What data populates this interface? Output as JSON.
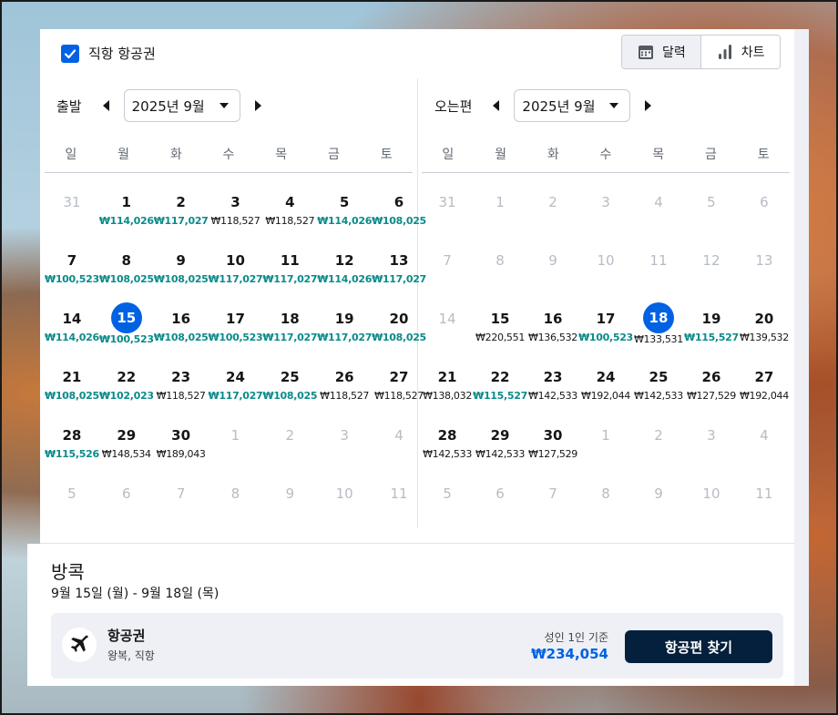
{
  "options": {
    "direct_label": "직항 항공권",
    "direct_checked": true
  },
  "view_toggle": {
    "calendar_label": "달력",
    "chart_label": "차트"
  },
  "weekdays": [
    "일",
    "월",
    "화",
    "수",
    "목",
    "금",
    "토"
  ],
  "depart": {
    "label": "출발",
    "month": "2025년 9월",
    "days": [
      {
        "d": "31",
        "muted": true
      },
      {
        "d": "1",
        "p": "₩114,026",
        "c": true
      },
      {
        "d": "2",
        "p": "₩117,027",
        "c": true
      },
      {
        "d": "3",
        "p": "₩118,527"
      },
      {
        "d": "4",
        "p": "₩118,527"
      },
      {
        "d": "5",
        "p": "₩114,026",
        "c": true
      },
      {
        "d": "6",
        "p": "₩108,025",
        "c": true
      },
      {
        "d": "7",
        "p": "₩100,523",
        "c": true
      },
      {
        "d": "8",
        "p": "₩108,025",
        "c": true
      },
      {
        "d": "9",
        "p": "₩108,025",
        "c": true
      },
      {
        "d": "10",
        "p": "₩117,027",
        "c": true
      },
      {
        "d": "11",
        "p": "₩117,027",
        "c": true
      },
      {
        "d": "12",
        "p": "₩114,026",
        "c": true
      },
      {
        "d": "13",
        "p": "₩117,027",
        "c": true
      },
      {
        "d": "14",
        "p": "₩114,026",
        "c": true
      },
      {
        "d": "15",
        "p": "₩100,523",
        "c": true,
        "sel": true
      },
      {
        "d": "16",
        "p": "₩108,025",
        "c": true
      },
      {
        "d": "17",
        "p": "₩100,523",
        "c": true
      },
      {
        "d": "18",
        "p": "₩117,027",
        "c": true
      },
      {
        "d": "19",
        "p": "₩117,027",
        "c": true
      },
      {
        "d": "20",
        "p": "₩108,025",
        "c": true
      },
      {
        "d": "21",
        "p": "₩108,025",
        "c": true
      },
      {
        "d": "22",
        "p": "₩102,023",
        "c": true
      },
      {
        "d": "23",
        "p": "₩118,527"
      },
      {
        "d": "24",
        "p": "₩117,027",
        "c": true
      },
      {
        "d": "25",
        "p": "₩108,025",
        "c": true
      },
      {
        "d": "26",
        "p": "₩118,527"
      },
      {
        "d": "27",
        "p": "₩118,527"
      },
      {
        "d": "28",
        "p": "₩115,526",
        "c": true
      },
      {
        "d": "29",
        "p": "₩148,534"
      },
      {
        "d": "30",
        "p": "₩189,043"
      },
      {
        "d": "1",
        "muted": true
      },
      {
        "d": "2",
        "muted": true
      },
      {
        "d": "3",
        "muted": true
      },
      {
        "d": "4",
        "muted": true
      },
      {
        "d": "5",
        "muted": true
      },
      {
        "d": "6",
        "muted": true
      },
      {
        "d": "7",
        "muted": true
      },
      {
        "d": "8",
        "muted": true
      },
      {
        "d": "9",
        "muted": true
      },
      {
        "d": "10",
        "muted": true
      },
      {
        "d": "11",
        "muted": true
      }
    ]
  },
  "return": {
    "label": "오는편",
    "month": "2025년 9월",
    "days": [
      {
        "d": "31",
        "muted": true
      },
      {
        "d": "1",
        "muted": true
      },
      {
        "d": "2",
        "muted": true
      },
      {
        "d": "3",
        "muted": true
      },
      {
        "d": "4",
        "muted": true
      },
      {
        "d": "5",
        "muted": true
      },
      {
        "d": "6",
        "muted": true
      },
      {
        "d": "7",
        "muted": true
      },
      {
        "d": "8",
        "muted": true
      },
      {
        "d": "9",
        "muted": true
      },
      {
        "d": "10",
        "muted": true
      },
      {
        "d": "11",
        "muted": true
      },
      {
        "d": "12",
        "muted": true
      },
      {
        "d": "13",
        "muted": true
      },
      {
        "d": "14",
        "muted": true
      },
      {
        "d": "15",
        "p": "₩220,551"
      },
      {
        "d": "16",
        "p": "₩136,532"
      },
      {
        "d": "17",
        "p": "₩100,523",
        "c": true
      },
      {
        "d": "18",
        "p": "₩133,531",
        "sel": true
      },
      {
        "d": "19",
        "p": "₩115,527",
        "c": true
      },
      {
        "d": "20",
        "p": "₩139,532"
      },
      {
        "d": "21",
        "p": "₩138,032"
      },
      {
        "d": "22",
        "p": "₩115,527",
        "c": true
      },
      {
        "d": "23",
        "p": "₩142,533"
      },
      {
        "d": "24",
        "p": "₩192,044"
      },
      {
        "d": "25",
        "p": "₩142,533"
      },
      {
        "d": "26",
        "p": "₩127,529"
      },
      {
        "d": "27",
        "p": "₩192,044"
      },
      {
        "d": "28",
        "p": "₩142,533"
      },
      {
        "d": "29",
        "p": "₩142,533"
      },
      {
        "d": "30",
        "p": "₩127,529"
      },
      {
        "d": "1",
        "muted": true
      },
      {
        "d": "2",
        "muted": true
      },
      {
        "d": "3",
        "muted": true
      },
      {
        "d": "4",
        "muted": true
      },
      {
        "d": "5",
        "muted": true
      },
      {
        "d": "6",
        "muted": true
      },
      {
        "d": "7",
        "muted": true
      },
      {
        "d": "8",
        "muted": true
      },
      {
        "d": "9",
        "muted": true
      },
      {
        "d": "10",
        "muted": true
      },
      {
        "d": "11",
        "muted": true
      }
    ]
  },
  "summary": {
    "destination": "방콕",
    "dates": "9월 15일 (월) - 9월 18일 (목)",
    "flight_title": "항공권",
    "flight_sub": "왕복, 직항",
    "basis": "성인 1인 기준",
    "price": "₩234,054",
    "find_button": "항공편 찾기"
  },
  "colors": {
    "accent": "#0062e3",
    "cheap": "#0b8a8a",
    "dark_button": "#05203c"
  }
}
